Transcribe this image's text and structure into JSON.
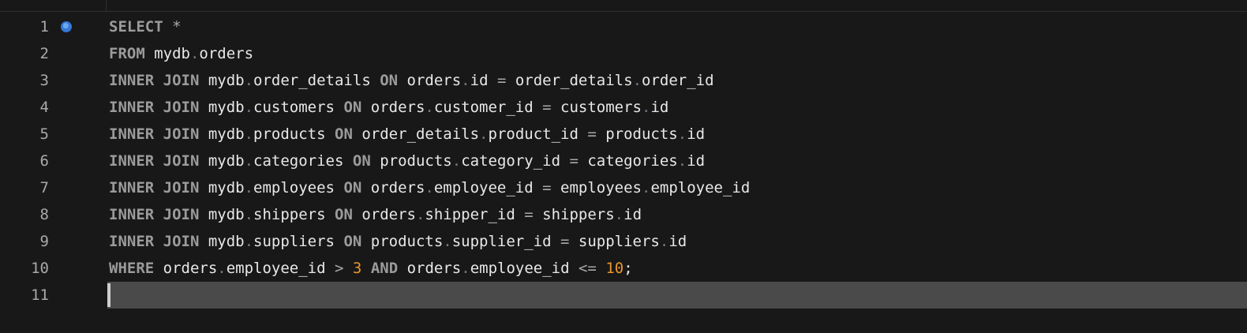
{
  "editor": {
    "breakpoint_line": 1,
    "cursor_line": 11,
    "colors": {
      "background": "#181818",
      "keyword": "#9b9b9b",
      "identifier": "#e8e8e8",
      "number": "#e9962e",
      "line_number": "#a9a9a9",
      "breakpoint": "#3578d8",
      "current_line": "#4a4a4a"
    },
    "lines": [
      {
        "number": "1",
        "tokens": [
          {
            "t": "kw",
            "v": "SELECT"
          },
          {
            "t": "id",
            "v": " "
          },
          {
            "t": "op",
            "v": "*"
          }
        ]
      },
      {
        "number": "2",
        "tokens": [
          {
            "t": "kw",
            "v": "FROM"
          },
          {
            "t": "id",
            "v": " mydb"
          },
          {
            "t": "pun",
            "v": "."
          },
          {
            "t": "id",
            "v": "orders"
          }
        ]
      },
      {
        "number": "3",
        "tokens": [
          {
            "t": "kw",
            "v": "INNER JOIN"
          },
          {
            "t": "id",
            "v": " mydb"
          },
          {
            "t": "pun",
            "v": "."
          },
          {
            "t": "id",
            "v": "order_details "
          },
          {
            "t": "kw",
            "v": "ON"
          },
          {
            "t": "id",
            "v": " orders"
          },
          {
            "t": "pun",
            "v": "."
          },
          {
            "t": "id",
            "v": "id "
          },
          {
            "t": "op",
            "v": "="
          },
          {
            "t": "id",
            "v": " order_details"
          },
          {
            "t": "pun",
            "v": "."
          },
          {
            "t": "id",
            "v": "order_id"
          }
        ]
      },
      {
        "number": "4",
        "tokens": [
          {
            "t": "kw",
            "v": "INNER JOIN"
          },
          {
            "t": "id",
            "v": " mydb"
          },
          {
            "t": "pun",
            "v": "."
          },
          {
            "t": "id",
            "v": "customers "
          },
          {
            "t": "kw",
            "v": "ON"
          },
          {
            "t": "id",
            "v": " orders"
          },
          {
            "t": "pun",
            "v": "."
          },
          {
            "t": "id",
            "v": "customer_id "
          },
          {
            "t": "op",
            "v": "="
          },
          {
            "t": "id",
            "v": " customers"
          },
          {
            "t": "pun",
            "v": "."
          },
          {
            "t": "id",
            "v": "id"
          }
        ]
      },
      {
        "number": "5",
        "tokens": [
          {
            "t": "kw",
            "v": "INNER JOIN"
          },
          {
            "t": "id",
            "v": " mydb"
          },
          {
            "t": "pun",
            "v": "."
          },
          {
            "t": "id",
            "v": "products "
          },
          {
            "t": "kw",
            "v": "ON"
          },
          {
            "t": "id",
            "v": " order_details"
          },
          {
            "t": "pun",
            "v": "."
          },
          {
            "t": "id",
            "v": "product_id "
          },
          {
            "t": "op",
            "v": "="
          },
          {
            "t": "id",
            "v": " products"
          },
          {
            "t": "pun",
            "v": "."
          },
          {
            "t": "id",
            "v": "id"
          }
        ]
      },
      {
        "number": "6",
        "tokens": [
          {
            "t": "kw",
            "v": "INNER JOIN"
          },
          {
            "t": "id",
            "v": " mydb"
          },
          {
            "t": "pun",
            "v": "."
          },
          {
            "t": "id",
            "v": "categories "
          },
          {
            "t": "kw",
            "v": "ON"
          },
          {
            "t": "id",
            "v": " products"
          },
          {
            "t": "pun",
            "v": "."
          },
          {
            "t": "id",
            "v": "category_id "
          },
          {
            "t": "op",
            "v": "="
          },
          {
            "t": "id",
            "v": " categories"
          },
          {
            "t": "pun",
            "v": "."
          },
          {
            "t": "id",
            "v": "id"
          }
        ]
      },
      {
        "number": "7",
        "tokens": [
          {
            "t": "kw",
            "v": "INNER JOIN"
          },
          {
            "t": "id",
            "v": " mydb"
          },
          {
            "t": "pun",
            "v": "."
          },
          {
            "t": "id",
            "v": "employees "
          },
          {
            "t": "kw",
            "v": "ON"
          },
          {
            "t": "id",
            "v": " orders"
          },
          {
            "t": "pun",
            "v": "."
          },
          {
            "t": "id",
            "v": "employee_id "
          },
          {
            "t": "op",
            "v": "="
          },
          {
            "t": "id",
            "v": " employees"
          },
          {
            "t": "pun",
            "v": "."
          },
          {
            "t": "id",
            "v": "employee_id"
          }
        ]
      },
      {
        "number": "8",
        "tokens": [
          {
            "t": "kw",
            "v": "INNER JOIN"
          },
          {
            "t": "id",
            "v": " mydb"
          },
          {
            "t": "pun",
            "v": "."
          },
          {
            "t": "id",
            "v": "shippers "
          },
          {
            "t": "kw",
            "v": "ON"
          },
          {
            "t": "id",
            "v": " orders"
          },
          {
            "t": "pun",
            "v": "."
          },
          {
            "t": "id",
            "v": "shipper_id "
          },
          {
            "t": "op",
            "v": "="
          },
          {
            "t": "id",
            "v": " shippers"
          },
          {
            "t": "pun",
            "v": "."
          },
          {
            "t": "id",
            "v": "id"
          }
        ]
      },
      {
        "number": "9",
        "tokens": [
          {
            "t": "kw",
            "v": "INNER JOIN"
          },
          {
            "t": "id",
            "v": " mydb"
          },
          {
            "t": "pun",
            "v": "."
          },
          {
            "t": "id",
            "v": "suppliers "
          },
          {
            "t": "kw",
            "v": "ON"
          },
          {
            "t": "id",
            "v": " products"
          },
          {
            "t": "pun",
            "v": "."
          },
          {
            "t": "id",
            "v": "supplier_id "
          },
          {
            "t": "op",
            "v": "="
          },
          {
            "t": "id",
            "v": " suppliers"
          },
          {
            "t": "pun",
            "v": "."
          },
          {
            "t": "id",
            "v": "id"
          }
        ]
      },
      {
        "number": "10",
        "tokens": [
          {
            "t": "kw",
            "v": "WHERE"
          },
          {
            "t": "id",
            "v": " orders"
          },
          {
            "t": "pun",
            "v": "."
          },
          {
            "t": "id",
            "v": "employee_id "
          },
          {
            "t": "op",
            "v": ">"
          },
          {
            "t": "id",
            "v": " "
          },
          {
            "t": "num",
            "v": "3"
          },
          {
            "t": "id",
            "v": " "
          },
          {
            "t": "kw",
            "v": "AND"
          },
          {
            "t": "id",
            "v": " orders"
          },
          {
            "t": "pun",
            "v": "."
          },
          {
            "t": "id",
            "v": "employee_id "
          },
          {
            "t": "op",
            "v": "<="
          },
          {
            "t": "id",
            "v": " "
          },
          {
            "t": "num",
            "v": "10"
          },
          {
            "t": "id",
            "v": ";"
          }
        ]
      },
      {
        "number": "11",
        "tokens": []
      }
    ]
  }
}
